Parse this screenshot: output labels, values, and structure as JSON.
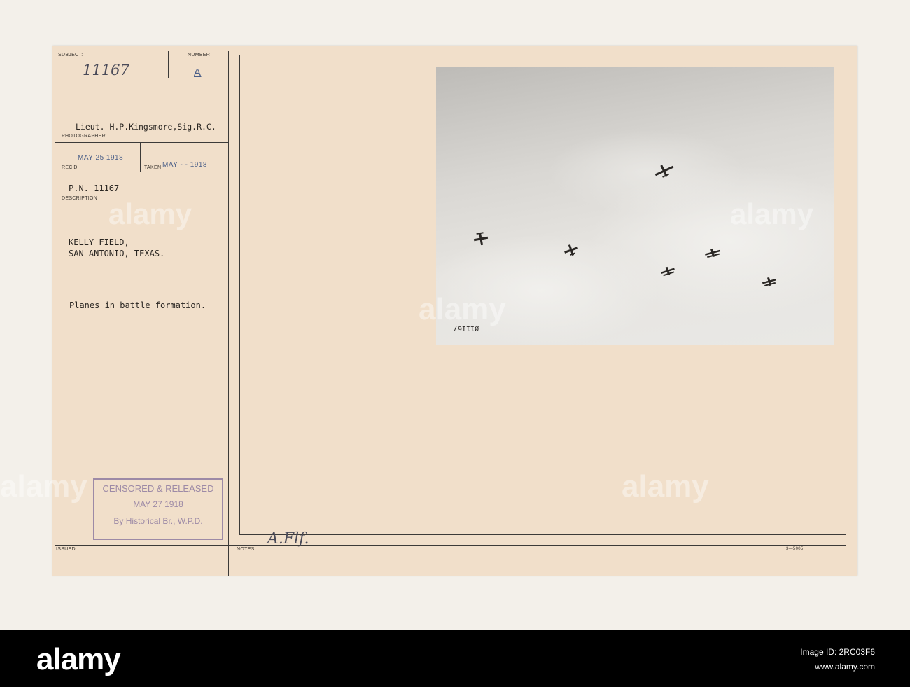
{
  "card": {
    "subject_label": "SUBJECT:",
    "number_label": "NUMBER",
    "subject_value": "11167",
    "number_value": "A",
    "photographer": "Lieut. H.P.Kingsmore,Sig.R.C.",
    "photographer_label": "PHOTOGRAPHER",
    "recd_label": "REC'D",
    "recd_date": "MAY 25 1918",
    "taken_label": "TAKEN",
    "taken_date": "MAY - - 1918",
    "pn": "P.N. 11167",
    "description_label": "DESCRIPTION",
    "location_line1": "KELLY FIELD,",
    "location_line2": "SAN ANTONIO, TEXAS.",
    "caption": "Planes in battle formation.",
    "issued_label": "ISSUED:",
    "notes_label": "NOTES:",
    "notes_handwriting": "A.Flf.",
    "form_number": "3—5005",
    "photo_number": "Ø11167"
  },
  "censor_stamp": {
    "line1": "CENSORED & RELEASED",
    "line2": "MAY 27 1918",
    "line3": "By Historical Br., W.P.D."
  },
  "watermark": {
    "text": "alamy"
  },
  "footer": {
    "logo": "alamy",
    "image_id_line": "Image ID: 2RC03F6",
    "url": "www.alamy.com"
  }
}
